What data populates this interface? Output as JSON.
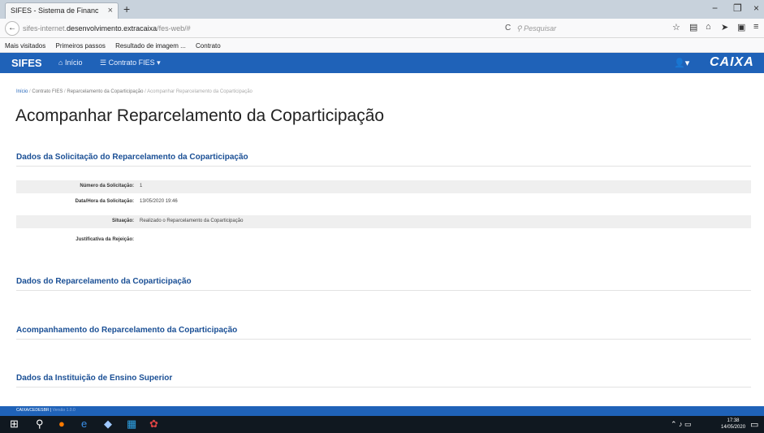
{
  "browser": {
    "tab_title": "SIFES - Sistema de Financiame...",
    "tab_close": "×",
    "new_tab": "+",
    "window": {
      "minimize": "−",
      "restore": "❐",
      "close": "×"
    },
    "back": "←",
    "url_prefix": "sifes-internet.",
    "url_host": "desenvolvimento.extracaixa",
    "url_suffix": "/fes-web/#",
    "reload": "C",
    "search_placeholder": "Pesquisar",
    "bookmarks": [
      "Mais visitados",
      "Primeiros passos",
      "Resultado de imagem ...",
      "Contrato"
    ]
  },
  "appbar": {
    "brand": "SIFES",
    "home": "Início",
    "contrato": "Contrato FIES",
    "user_caret": "▾",
    "logo_text": "CAIXA"
  },
  "breadcrumb": [
    "Início",
    "Contrato FIES",
    "Reparcelamento da Coparticipação",
    "Acompanhar Reparcelamento da Coparticipação"
  ],
  "page_title": "Acompanhar Reparcelamento da Coparticipação",
  "sections": {
    "solicitacao": "Dados da Solicitação do Reparcelamento da Coparticipação",
    "reparcelamento": "Dados do Reparcelamento da Coparticipação",
    "acompanhamento": "Acompanhamento do Reparcelamento da Coparticipação",
    "instituicao": "Dados da Instituição de Ensino Superior"
  },
  "fields": [
    {
      "label": "Número da Solicitação:",
      "value": "1"
    },
    {
      "label": "Data/Hora da Solicitação:",
      "value": "13/05/2020 19:46"
    },
    {
      "label": "Situação:",
      "value": "Realizado o Reparcelamento da Coparticipação"
    },
    {
      "label": "Justificativa da Rejeição:",
      "value": ""
    }
  ],
  "footer": {
    "org": "CAIXA/CEDESBR |",
    "version": "Versão 1.0.0"
  },
  "taskbar": {
    "time": "17:38",
    "date": "14/05/2020"
  }
}
